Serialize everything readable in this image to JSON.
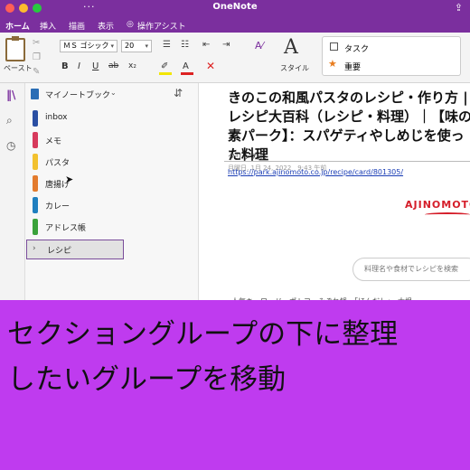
{
  "window": {
    "title": "OneNote",
    "more_icon": "ellipsis-icon",
    "share_icon": "share-icon"
  },
  "ribbon_tabs": [
    {
      "label": "ホーム",
      "active": true
    },
    {
      "label": "挿入",
      "active": false
    },
    {
      "label": "描画",
      "active": false
    },
    {
      "label": "表示",
      "active": false
    },
    {
      "label": "操作アシスト",
      "active": false
    }
  ],
  "ribbon": {
    "paste_label": "ペースト",
    "font_name": "ＭＳ ゴシック",
    "font_size": "20",
    "bold": "B",
    "italic": "I",
    "underline": "U",
    "strike": "ab",
    "subscript": "x₂",
    "font_color": "A",
    "style_glyph": "A",
    "style_label": "スタイル",
    "tags": {
      "todo": "タスク",
      "important": "重要"
    }
  },
  "notebook": {
    "name": "マイノートブック",
    "sections": [
      {
        "label": "inbox",
        "color": "#2a4fa3"
      },
      {
        "label": "メモ",
        "color": "#d73a5c"
      },
      {
        "label": "パスタ",
        "color": "#f2c12e"
      },
      {
        "label": "唐揚げ",
        "color": "#e37b2d"
      },
      {
        "label": "カレー",
        "color": "#1f7fbf"
      },
      {
        "label": "アドレス帳",
        "color": "#3aa23a"
      }
    ],
    "section_group": {
      "label": "レシピ",
      "expanded": false
    }
  },
  "page": {
    "title": "きのこの和風パスタのレシピ・作り方 | レシピ大百科（レシピ・料理）｜【味の素パーク】：スパゲティやしめじを使った料理",
    "clip_label": "クリップ元:",
    "date": "月曜日, 1月 24, 2022　9:43 午前",
    "source_url": "https://park.ajinomoto.co.jp/recipe/card/801305/",
    "brand": "AJINOMOTO",
    "search_placeholder": "料理名や食材でレシピを検索",
    "keywords": "人気キーワード　ポトフ　みぞれ鍋　「ほんだし」　大根"
  },
  "caption": {
    "line1": "セクショングループの下に整理",
    "line2": "したいグループを移動"
  }
}
